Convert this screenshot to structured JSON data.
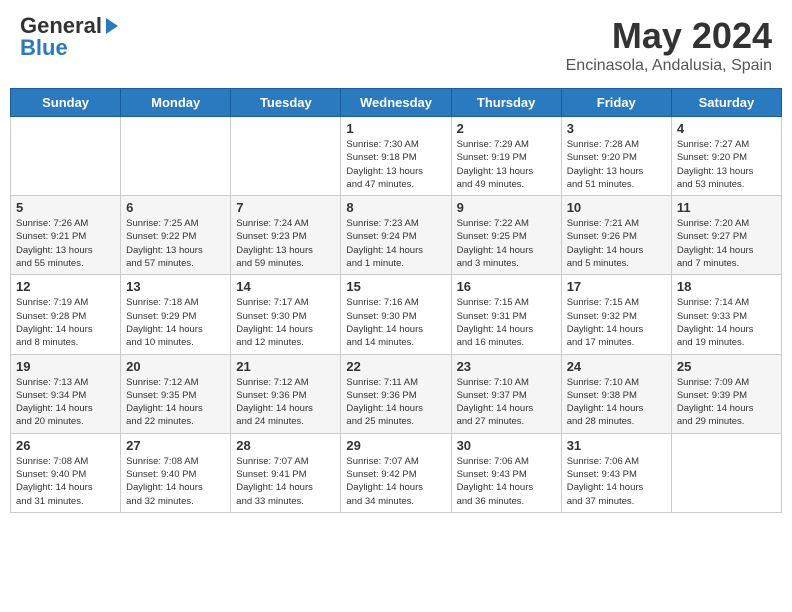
{
  "header": {
    "logo_general": "General",
    "logo_blue": "Blue",
    "month_title": "May 2024",
    "location": "Encinasola, Andalusia, Spain"
  },
  "weekdays": [
    "Sunday",
    "Monday",
    "Tuesday",
    "Wednesday",
    "Thursday",
    "Friday",
    "Saturday"
  ],
  "weeks": [
    [
      {
        "day": "",
        "info": ""
      },
      {
        "day": "",
        "info": ""
      },
      {
        "day": "",
        "info": ""
      },
      {
        "day": "1",
        "info": "Sunrise: 7:30 AM\nSunset: 9:18 PM\nDaylight: 13 hours\nand 47 minutes."
      },
      {
        "day": "2",
        "info": "Sunrise: 7:29 AM\nSunset: 9:19 PM\nDaylight: 13 hours\nand 49 minutes."
      },
      {
        "day": "3",
        "info": "Sunrise: 7:28 AM\nSunset: 9:20 PM\nDaylight: 13 hours\nand 51 minutes."
      },
      {
        "day": "4",
        "info": "Sunrise: 7:27 AM\nSunset: 9:20 PM\nDaylight: 13 hours\nand 53 minutes."
      }
    ],
    [
      {
        "day": "5",
        "info": "Sunrise: 7:26 AM\nSunset: 9:21 PM\nDaylight: 13 hours\nand 55 minutes."
      },
      {
        "day": "6",
        "info": "Sunrise: 7:25 AM\nSunset: 9:22 PM\nDaylight: 13 hours\nand 57 minutes."
      },
      {
        "day": "7",
        "info": "Sunrise: 7:24 AM\nSunset: 9:23 PM\nDaylight: 13 hours\nand 59 minutes."
      },
      {
        "day": "8",
        "info": "Sunrise: 7:23 AM\nSunset: 9:24 PM\nDaylight: 14 hours\nand 1 minute."
      },
      {
        "day": "9",
        "info": "Sunrise: 7:22 AM\nSunset: 9:25 PM\nDaylight: 14 hours\nand 3 minutes."
      },
      {
        "day": "10",
        "info": "Sunrise: 7:21 AM\nSunset: 9:26 PM\nDaylight: 14 hours\nand 5 minutes."
      },
      {
        "day": "11",
        "info": "Sunrise: 7:20 AM\nSunset: 9:27 PM\nDaylight: 14 hours\nand 7 minutes."
      }
    ],
    [
      {
        "day": "12",
        "info": "Sunrise: 7:19 AM\nSunset: 9:28 PM\nDaylight: 14 hours\nand 8 minutes."
      },
      {
        "day": "13",
        "info": "Sunrise: 7:18 AM\nSunset: 9:29 PM\nDaylight: 14 hours\nand 10 minutes."
      },
      {
        "day": "14",
        "info": "Sunrise: 7:17 AM\nSunset: 9:30 PM\nDaylight: 14 hours\nand 12 minutes."
      },
      {
        "day": "15",
        "info": "Sunrise: 7:16 AM\nSunset: 9:30 PM\nDaylight: 14 hours\nand 14 minutes."
      },
      {
        "day": "16",
        "info": "Sunrise: 7:15 AM\nSunset: 9:31 PM\nDaylight: 14 hours\nand 16 minutes."
      },
      {
        "day": "17",
        "info": "Sunrise: 7:15 AM\nSunset: 9:32 PM\nDaylight: 14 hours\nand 17 minutes."
      },
      {
        "day": "18",
        "info": "Sunrise: 7:14 AM\nSunset: 9:33 PM\nDaylight: 14 hours\nand 19 minutes."
      }
    ],
    [
      {
        "day": "19",
        "info": "Sunrise: 7:13 AM\nSunset: 9:34 PM\nDaylight: 14 hours\nand 20 minutes."
      },
      {
        "day": "20",
        "info": "Sunrise: 7:12 AM\nSunset: 9:35 PM\nDaylight: 14 hours\nand 22 minutes."
      },
      {
        "day": "21",
        "info": "Sunrise: 7:12 AM\nSunset: 9:36 PM\nDaylight: 14 hours\nand 24 minutes."
      },
      {
        "day": "22",
        "info": "Sunrise: 7:11 AM\nSunset: 9:36 PM\nDaylight: 14 hours\nand 25 minutes."
      },
      {
        "day": "23",
        "info": "Sunrise: 7:10 AM\nSunset: 9:37 PM\nDaylight: 14 hours\nand 27 minutes."
      },
      {
        "day": "24",
        "info": "Sunrise: 7:10 AM\nSunset: 9:38 PM\nDaylight: 14 hours\nand 28 minutes."
      },
      {
        "day": "25",
        "info": "Sunrise: 7:09 AM\nSunset: 9:39 PM\nDaylight: 14 hours\nand 29 minutes."
      }
    ],
    [
      {
        "day": "26",
        "info": "Sunrise: 7:08 AM\nSunset: 9:40 PM\nDaylight: 14 hours\nand 31 minutes."
      },
      {
        "day": "27",
        "info": "Sunrise: 7:08 AM\nSunset: 9:40 PM\nDaylight: 14 hours\nand 32 minutes."
      },
      {
        "day": "28",
        "info": "Sunrise: 7:07 AM\nSunset: 9:41 PM\nDaylight: 14 hours\nand 33 minutes."
      },
      {
        "day": "29",
        "info": "Sunrise: 7:07 AM\nSunset: 9:42 PM\nDaylight: 14 hours\nand 34 minutes."
      },
      {
        "day": "30",
        "info": "Sunrise: 7:06 AM\nSunset: 9:43 PM\nDaylight: 14 hours\nand 36 minutes."
      },
      {
        "day": "31",
        "info": "Sunrise: 7:06 AM\nSunset: 9:43 PM\nDaylight: 14 hours\nand 37 minutes."
      },
      {
        "day": "",
        "info": ""
      }
    ]
  ]
}
